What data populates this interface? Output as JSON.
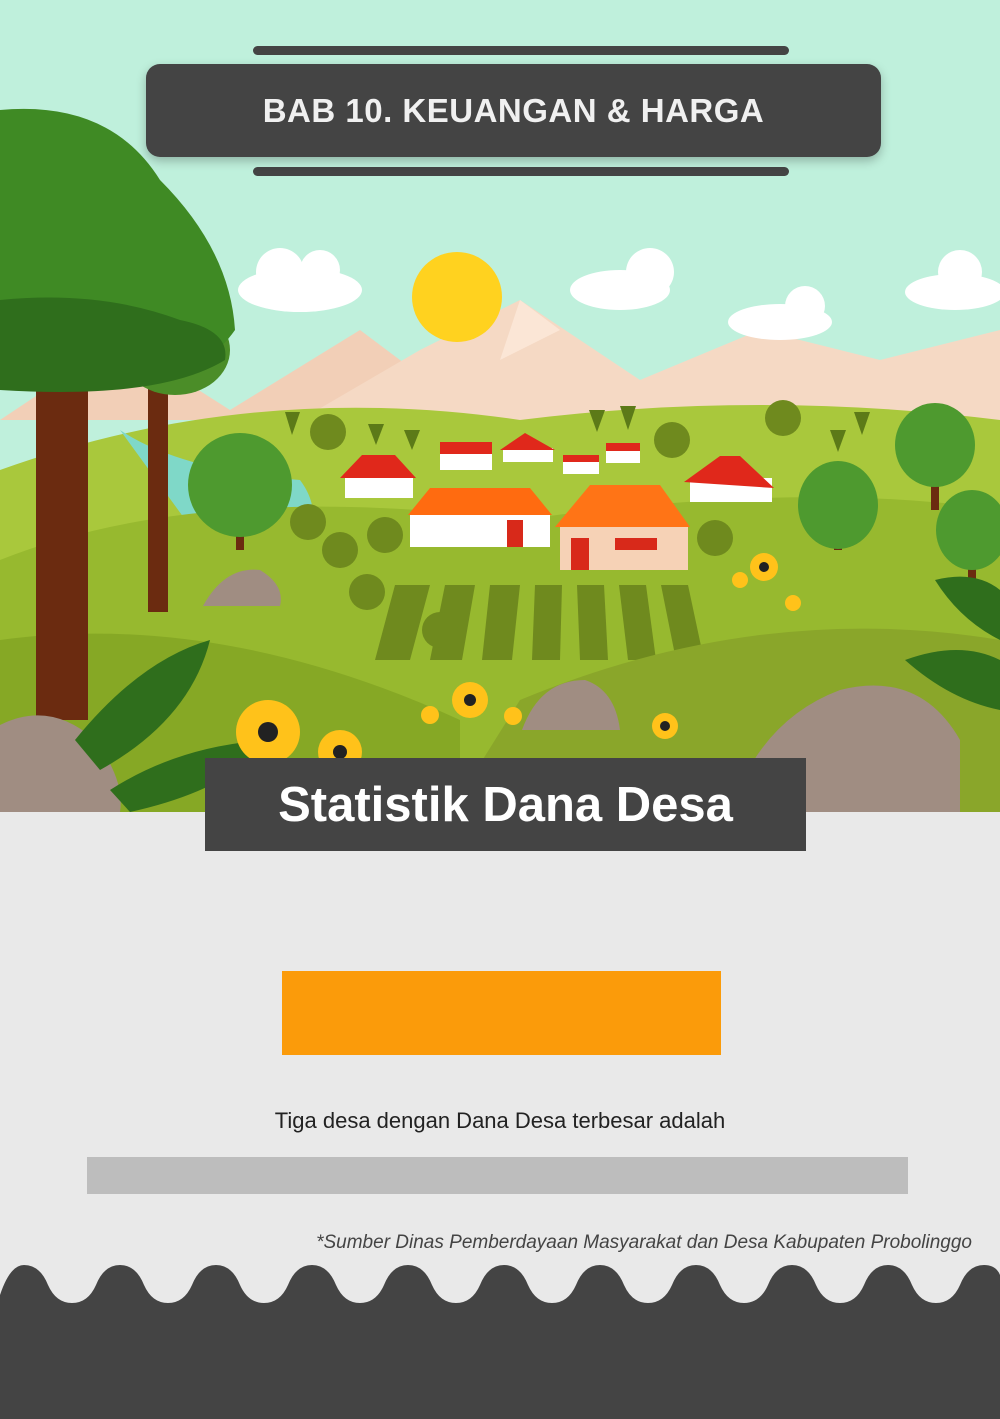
{
  "header": {
    "chapter_title": "BAB 10. KEUANGAN & HARGA"
  },
  "main": {
    "title": "Statistik Dana Desa",
    "description": "Tiga desa dengan Dana Desa terbesar adalah",
    "source": "*Sumber Dinas Pemberdayaan Masyarakat dan Desa Kabupaten Probolinggo"
  },
  "colors": {
    "sky": "#bff0dc",
    "dark": "#444444",
    "accent_orange": "#fb9b0a",
    "placeholder_gray": "#bdbdbd",
    "background": "#e9e9e9",
    "grass": "#9fbf35"
  },
  "icons": [
    "tree-icon",
    "sun-icon",
    "cloud-icon",
    "house-icon",
    "flower-icon",
    "rock-icon",
    "mountain-icon"
  ]
}
